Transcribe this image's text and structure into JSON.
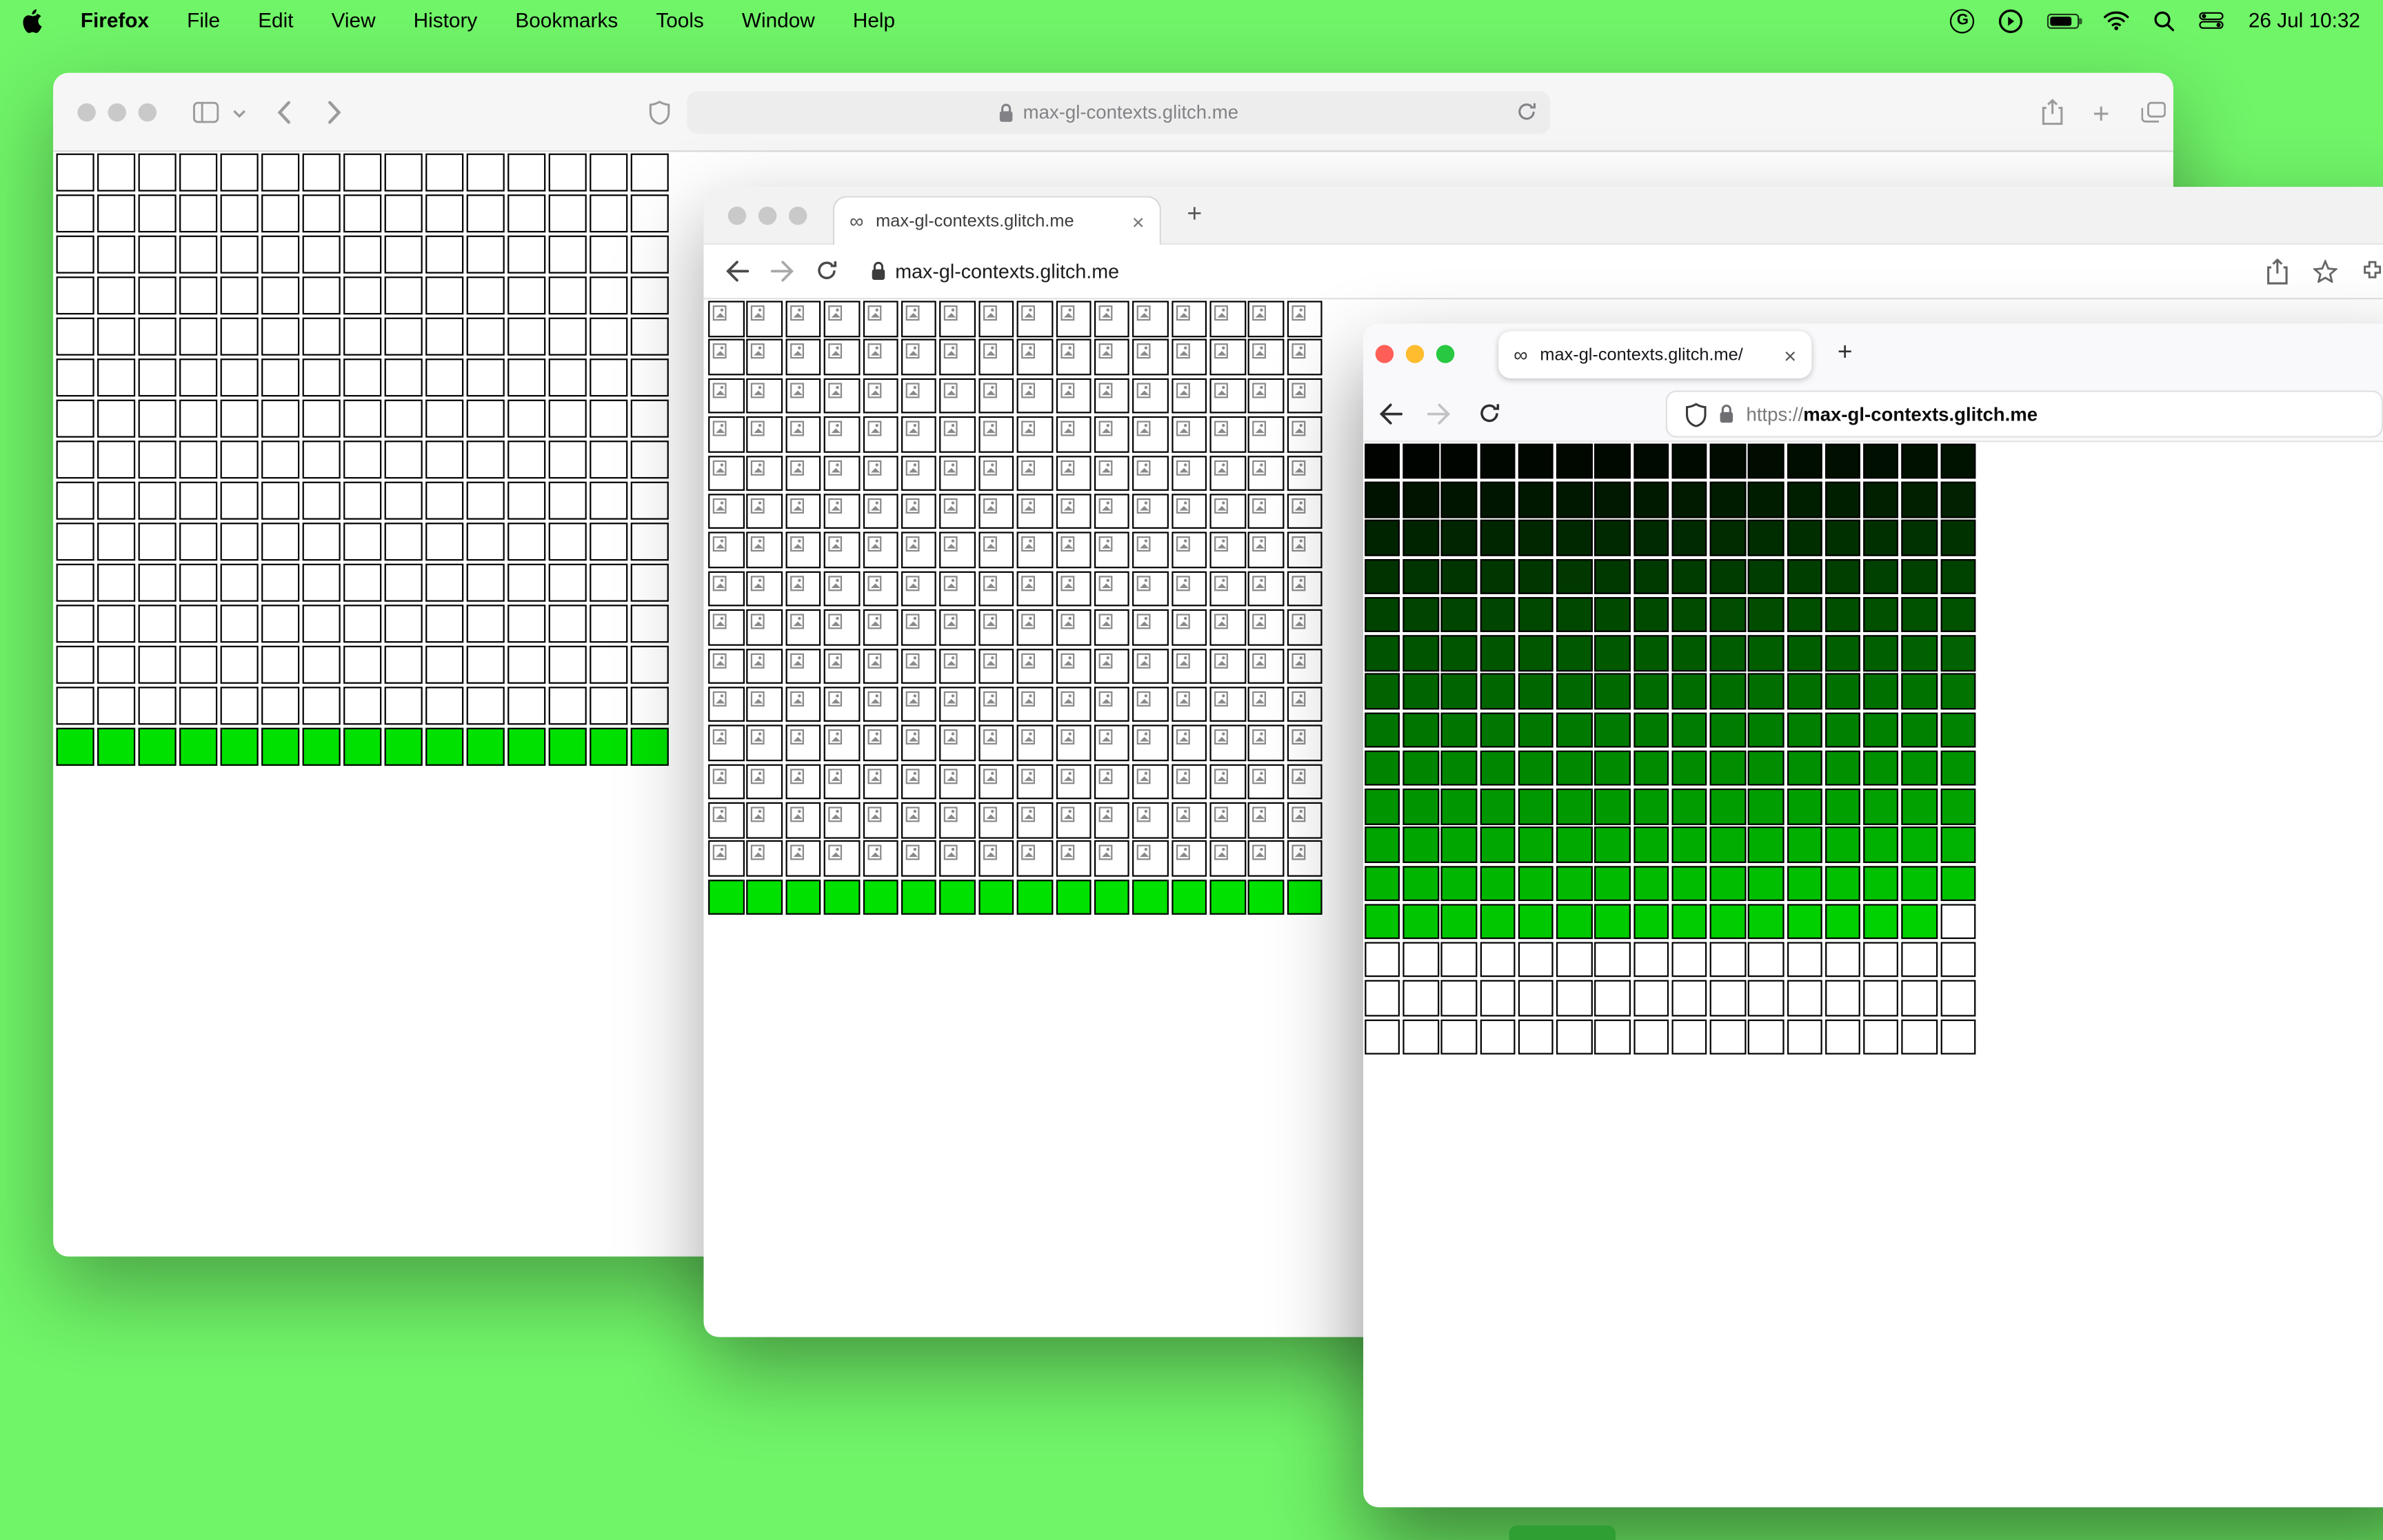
{
  "desktop": {
    "bg": "#70f468",
    "dock_color": "#2f9e33"
  },
  "menu_bar": {
    "app_name": "Firefox",
    "items": [
      "File",
      "Edit",
      "View",
      "History",
      "Bookmarks",
      "Tools",
      "Window",
      "Help"
    ],
    "clock": "26 Jul 10:32"
  },
  "safari_window": {
    "url": "max-gl-contexts.glitch.me"
  },
  "middle_window": {
    "tab_favicon": "∞",
    "tab_title": "max-gl-contexts.glitch.me",
    "url": "max-gl-contexts.glitch.me"
  },
  "firefox_window": {
    "tab_favicon": "∞",
    "tab_title": "max-gl-contexts.glitch.me/",
    "url_scheme": "https://",
    "url_host": "max-gl-contexts.glitch.me"
  },
  "glyphs": {
    "plus": "+",
    "close": "×",
    "infinity": "∞"
  },
  "grids": {
    "safari": {
      "cols": 15,
      "rows": 15,
      "cell": 25,
      "gap": 2,
      "pattern": "white-green",
      "green_rows": 1,
      "white": "#ffffff",
      "green": "#00e100",
      "border": "#000000"
    },
    "middle": {
      "cols": 16,
      "rows": 16,
      "cell": 23.5,
      "gap": 1.9,
      "pattern": "broken-green",
      "green_rows": 1,
      "white": "#ffffff",
      "green": "#00e100",
      "border": "#000000"
    },
    "firefox": {
      "cols": 16,
      "rows": 16,
      "cell": 23.4,
      "gap": 1.85,
      "pattern": "gradient",
      "colored_cells": 207,
      "gradient_start": "#000300",
      "gradient_end": "#00d200",
      "white": "#ffffff",
      "border": "#000000"
    }
  }
}
